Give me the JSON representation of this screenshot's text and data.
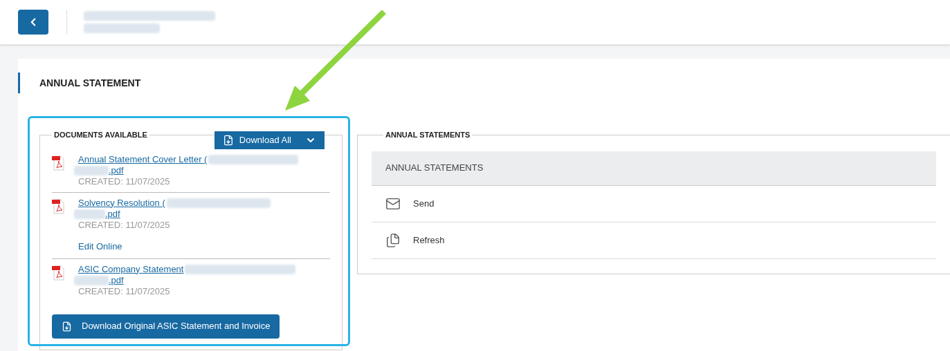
{
  "page": {
    "title": "ANNUAL STATEMENT"
  },
  "documents": {
    "title": "DOCUMENTS AVAILABLE",
    "download_all": "Download All",
    "files": [
      {
        "name": "Annual Statement Cover Letter (",
        "extension": ".pdf",
        "created": "CREATED: 11/07/2025"
      },
      {
        "name": "Solvency Resolution (",
        "extension": ".pdf",
        "created": "CREATED: 11/07/2025",
        "edit_link": "Edit Online"
      },
      {
        "name": "ASIC Company Statement",
        "extension": ".pdf",
        "created": "CREATED: 11/07/2025"
      }
    ],
    "download_original": "Download Original ASIC Statement and Invoice"
  },
  "annual_statements": {
    "title": "ANNUAL STATEMENTS",
    "table_header": "ANNUAL STATEMENTS",
    "actions": [
      {
        "kind": "send",
        "label": "Send"
      },
      {
        "kind": "refresh",
        "label": "Refresh"
      }
    ]
  }
}
